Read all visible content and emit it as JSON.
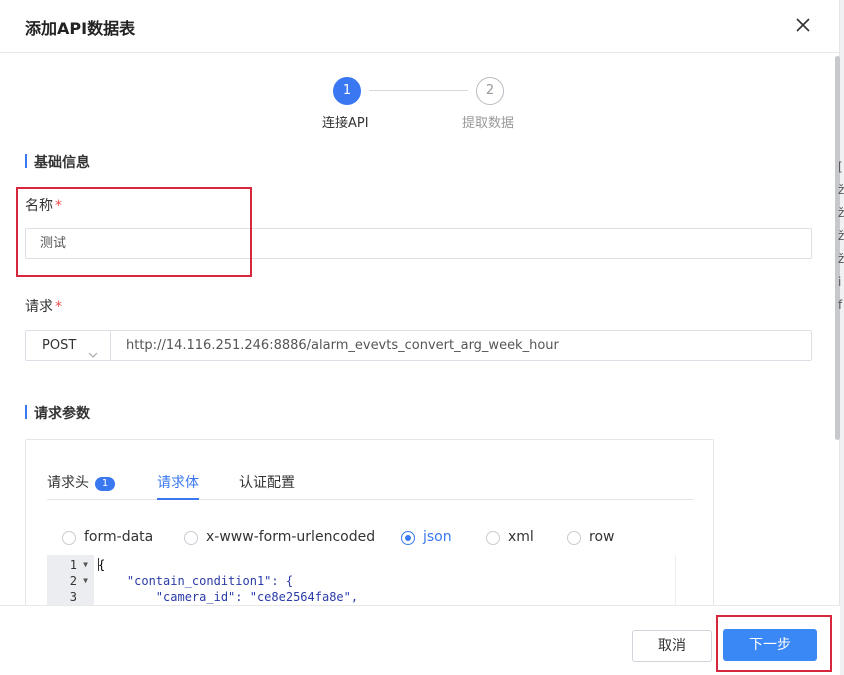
{
  "dialog": {
    "title": "添加API数据表"
  },
  "steps": [
    {
      "number": "1",
      "label": "连接API"
    },
    {
      "number": "2",
      "label": "提取数据"
    }
  ],
  "basic_info": {
    "section_title": "基础信息",
    "name_label": "名称",
    "name_value": "测试",
    "request_label": "请求",
    "required_mark": "*",
    "method": "POST",
    "url": "http://14.116.251.246:8886/alarm_evevts_convert_arg_week_hour"
  },
  "params": {
    "section_title": "请求参数",
    "tabs": [
      {
        "label": "请求头",
        "badge": "1"
      },
      {
        "label": "请求体"
      },
      {
        "label": "认证配置"
      }
    ],
    "body_types": [
      "form-data",
      "x-www-form-urlencoded",
      "json",
      "xml",
      "row"
    ],
    "selected_body_type": "json",
    "editor": {
      "line_numbers": [
        "1",
        "2",
        "3"
      ],
      "lines": [
        "{",
        "    \"contain_condition1\": {",
        "        \"camera_id\": \"ce8e2564fa8e\","
      ]
    }
  },
  "footer": {
    "cancel_label": "取消",
    "next_label": "下一步"
  },
  "background_chars": [
    "[",
    "ž",
    "ž",
    "ž",
    "ž",
    "i",
    "f"
  ],
  "colors": {
    "primary": "#3a78f2",
    "highlight": "#d7263d",
    "required": "#f04a4a"
  }
}
